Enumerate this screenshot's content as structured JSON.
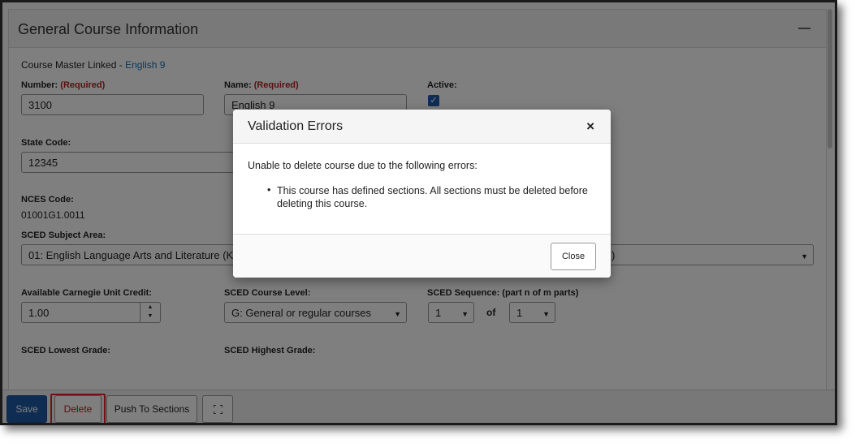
{
  "panel": {
    "title": "General Course Information",
    "course_master_prefix": "Course Master Linked - ",
    "course_master_link": "English 9"
  },
  "fields": {
    "number_label": "Number:",
    "number_required": "(Required)",
    "number_value": "3100",
    "name_label": "Name:",
    "name_required": "(Required)",
    "name_value": "English 9",
    "active_label": "Active:",
    "active_checked": true,
    "state_code_label": "State Code:",
    "state_code_value": "12345",
    "nces_label": "NCES Code:",
    "nces_value": "01001G1.0011",
    "sced_subject_label": "SCED Subject Area:",
    "sced_subject_value": "01: English Language Arts and Literature (K-12",
    "sced_subject_right_fragment": ")",
    "carnegie_label": "Available Carnegie Unit Credit:",
    "carnegie_value": "1.00",
    "course_level_label": "SCED Course Level:",
    "course_level_value": "G: General or regular courses",
    "sequence_label": "SCED Sequence: (part n of m parts)",
    "sequence_n": "1",
    "sequence_of": "of",
    "sequence_m": "1",
    "lowest_grade_label": "SCED Lowest Grade:",
    "highest_grade_label": "SCED Highest Grade:"
  },
  "footer": {
    "save": "Save",
    "delete": "Delete",
    "push": "Push To Sections"
  },
  "modal": {
    "title": "Validation Errors",
    "close_x": "×",
    "message": "Unable to delete course due to the following errors:",
    "errors": [
      "This course has defined sections. All sections must be deleted before deleting this course."
    ],
    "close_button": "Close"
  },
  "colors": {
    "save_bg": "#1f5aa6",
    "delete_highlight": "#e0242e",
    "required": "#b0231f",
    "link": "#1a6fb5"
  }
}
